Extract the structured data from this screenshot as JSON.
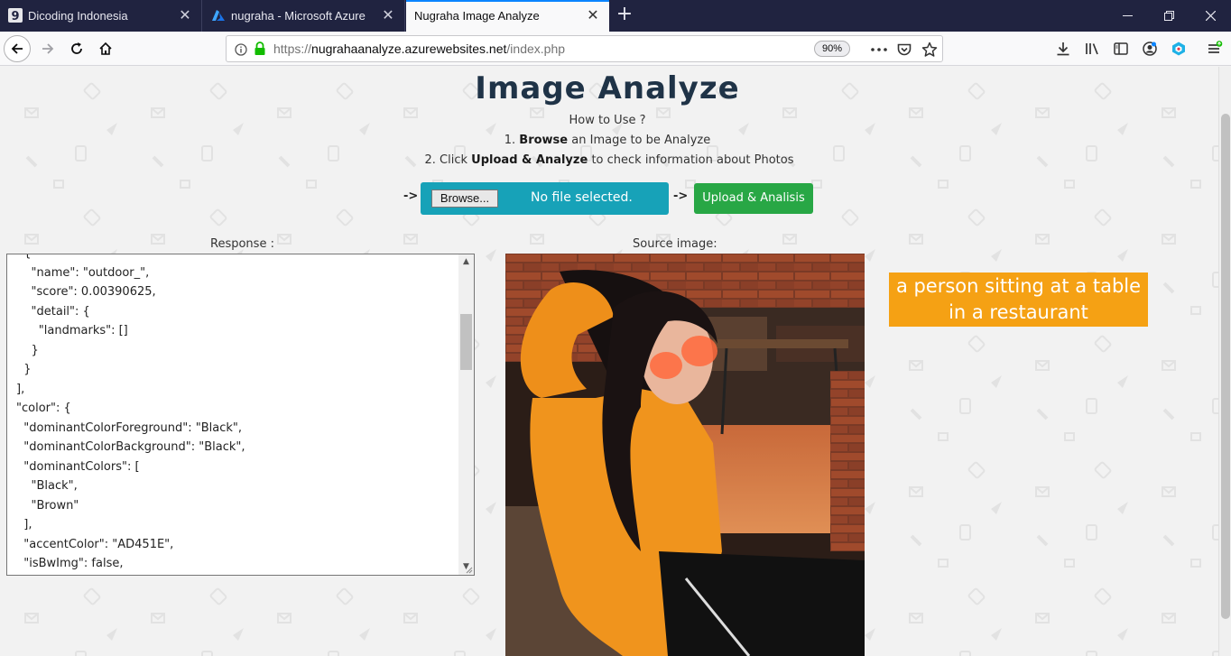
{
  "browser": {
    "tabs": [
      {
        "label": "Dicoding Indonesia",
        "icon": "dicoding-icon"
      },
      {
        "label": "nugraha - Microsoft Azure",
        "icon": "azure-icon"
      },
      {
        "label": "Nugraha Image Analyze",
        "icon": ""
      }
    ],
    "url_prefix": "https://",
    "url_host": "nugrahaanalyze.azurewebsites.net",
    "url_path": "/index.php",
    "zoom": "90%"
  },
  "page": {
    "title": "Image Analyze",
    "how_to": "How to Use ?",
    "step1_prefix": "1.",
    "step1_bold": "Browse",
    "step1_suffix": "an Image to be Analyze",
    "step2_prefix": "2. Click",
    "step2_bold": "Upload & Analyze",
    "step2_suffix": "to check information about Photos",
    "arrow": "->",
    "browse_label": "Browse...",
    "no_file": "No file selected.",
    "submit_label": "Upload & Analisis",
    "response_label": "Response :",
    "source_label": "Source image:",
    "response_json": "  {\n    \"name\": \"outdoor_\",\n    \"score\": 0.00390625,\n    \"detail\": {\n      \"landmarks\": []\n    }\n  }\n],\n\"color\": {\n  \"dominantColorForeground\": \"Black\",\n  \"dominantColorBackground\": \"Black\",\n  \"dominantColors\": [\n    \"Black\",\n    \"Brown\"\n  ],\n  \"accentColor\": \"AD451E\",\n  \"isBwImg\": false,",
    "caption": "a person sitting at a table in a restaurant"
  },
  "colors": {
    "upload_box": "#17a2b8",
    "submit_button": "#28a745",
    "caption_bg": "#f5a114",
    "title": "#1f3347"
  }
}
